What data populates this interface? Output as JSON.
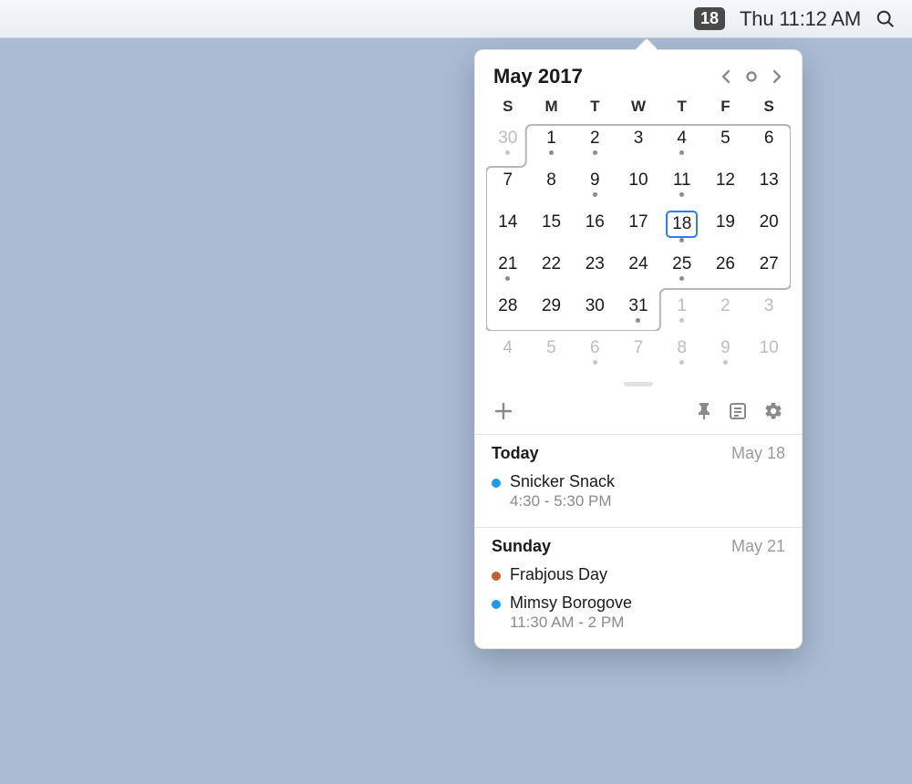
{
  "menubar": {
    "date_badge": "18",
    "clock": "Thu 11:12 AM"
  },
  "calendar": {
    "title": "May 2017",
    "weekdays": [
      "S",
      "M",
      "T",
      "W",
      "T",
      "F",
      "S"
    ],
    "today_num": 18,
    "days": [
      {
        "n": 30,
        "other": true,
        "dot": true
      },
      {
        "n": 1,
        "other": false,
        "dot": true
      },
      {
        "n": 2,
        "other": false,
        "dot": true
      },
      {
        "n": 3,
        "other": false,
        "dot": false
      },
      {
        "n": 4,
        "other": false,
        "dot": true
      },
      {
        "n": 5,
        "other": false,
        "dot": false
      },
      {
        "n": 6,
        "other": false,
        "dot": false
      },
      {
        "n": 7,
        "other": false,
        "dot": false
      },
      {
        "n": 8,
        "other": false,
        "dot": false
      },
      {
        "n": 9,
        "other": false,
        "dot": true
      },
      {
        "n": 10,
        "other": false,
        "dot": false
      },
      {
        "n": 11,
        "other": false,
        "dot": true
      },
      {
        "n": 12,
        "other": false,
        "dot": false
      },
      {
        "n": 13,
        "other": false,
        "dot": false
      },
      {
        "n": 14,
        "other": false,
        "dot": false
      },
      {
        "n": 15,
        "other": false,
        "dot": false
      },
      {
        "n": 16,
        "other": false,
        "dot": false
      },
      {
        "n": 17,
        "other": false,
        "dot": false
      },
      {
        "n": 18,
        "other": false,
        "dot": true
      },
      {
        "n": 19,
        "other": false,
        "dot": false
      },
      {
        "n": 20,
        "other": false,
        "dot": false
      },
      {
        "n": 21,
        "other": false,
        "dot": true
      },
      {
        "n": 22,
        "other": false,
        "dot": false
      },
      {
        "n": 23,
        "other": false,
        "dot": false
      },
      {
        "n": 24,
        "other": false,
        "dot": false
      },
      {
        "n": 25,
        "other": false,
        "dot": true
      },
      {
        "n": 26,
        "other": false,
        "dot": false
      },
      {
        "n": 27,
        "other": false,
        "dot": false
      },
      {
        "n": 28,
        "other": false,
        "dot": false
      },
      {
        "n": 29,
        "other": false,
        "dot": false
      },
      {
        "n": 30,
        "other": false,
        "dot": false
      },
      {
        "n": 31,
        "other": false,
        "dot": true
      },
      {
        "n": 1,
        "other": true,
        "dot": true
      },
      {
        "n": 2,
        "other": true,
        "dot": false
      },
      {
        "n": 3,
        "other": true,
        "dot": false
      },
      {
        "n": 4,
        "other": true,
        "dot": false
      },
      {
        "n": 5,
        "other": true,
        "dot": false
      },
      {
        "n": 6,
        "other": true,
        "dot": true
      },
      {
        "n": 7,
        "other": true,
        "dot": false
      },
      {
        "n": 8,
        "other": true,
        "dot": true
      },
      {
        "n": 9,
        "other": true,
        "dot": true
      },
      {
        "n": 10,
        "other": true,
        "dot": false
      }
    ]
  },
  "colors": {
    "blue": "#1E9AF4",
    "orange": "#C65D3C"
  },
  "agenda": [
    {
      "label": "Today",
      "date": "May 18",
      "events": [
        {
          "color": "blue",
          "title": "Snicker Snack",
          "time": "4:30 - 5:30 PM"
        }
      ]
    },
    {
      "label": "Sunday",
      "date": "May 21",
      "events": [
        {
          "color": "orange",
          "title": "Frabjous Day",
          "time": ""
        },
        {
          "color": "blue",
          "title": "Mimsy Borogove",
          "time": "11:30 AM - 2 PM"
        }
      ]
    }
  ]
}
